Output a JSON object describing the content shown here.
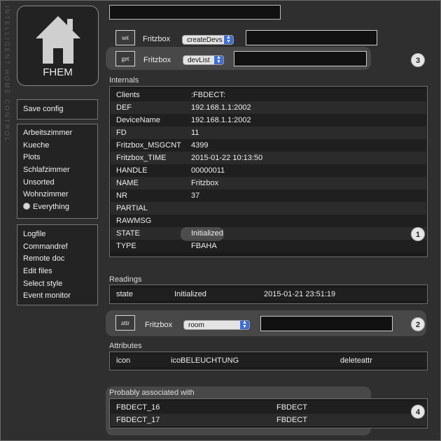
{
  "logo": {
    "text": "FHEM"
  },
  "side_label": "INTELLIGENT HOME CONTROL",
  "menu_save": {
    "items": [
      "Save config"
    ]
  },
  "menu_rooms": {
    "items": [
      "Arbeitszimmer",
      "Kueche",
      "Plots",
      "Schlafzimmer",
      "Unsorted",
      "Wohnzimmer",
      "Everything"
    ]
  },
  "menu_tools": {
    "items": [
      "Logfile",
      "Commandref",
      "Remote doc",
      "Edit files",
      "Select style",
      "Event monitor"
    ]
  },
  "set_cmd": {
    "button": "set",
    "device": "Fritzbox",
    "select": "createDevs"
  },
  "get_cmd": {
    "button": "get",
    "device": "Fritzbox",
    "select": "devList"
  },
  "attr_cmd": {
    "button": "attr",
    "device": "Fritzbox",
    "select": "room"
  },
  "badges": [
    "1",
    "2",
    "3",
    "4"
  ],
  "internals": {
    "title": "Internals",
    "rows": [
      [
        "Clients",
        ":FBDECT:"
      ],
      [
        "DEF",
        "192.168.1.1:2002"
      ],
      [
        "DeviceName",
        "192.168.1.1:2002"
      ],
      [
        "FD",
        "11"
      ],
      [
        "Fritzbox_MSGCNT",
        "4399"
      ],
      [
        "Fritzbox_TIME",
        "2015-01-22 10:13:50"
      ],
      [
        "HANDLE",
        "00000011"
      ],
      [
        "NAME",
        "Fritzbox"
      ],
      [
        "NR",
        "37"
      ],
      [
        "PARTIAL",
        ""
      ],
      [
        "RAWMSG",
        ""
      ],
      [
        "STATE",
        "Initialized"
      ],
      [
        "TYPE",
        "FBAHA"
      ]
    ]
  },
  "readings": {
    "title": "Readings",
    "rows": [
      [
        "state",
        "Initialized",
        "2015-01-21 23:51:19"
      ]
    ]
  },
  "attributes": {
    "title": "Attributes",
    "rows": [
      [
        "icon",
        "icoBELEUCHTUNG",
        "deleteattr"
      ]
    ]
  },
  "associated": {
    "title": "Probably associated with",
    "rows": [
      [
        "FBDECT_16",
        "FBDECT"
      ],
      [
        "FBDECT_17",
        "FBDECT"
      ]
    ]
  }
}
